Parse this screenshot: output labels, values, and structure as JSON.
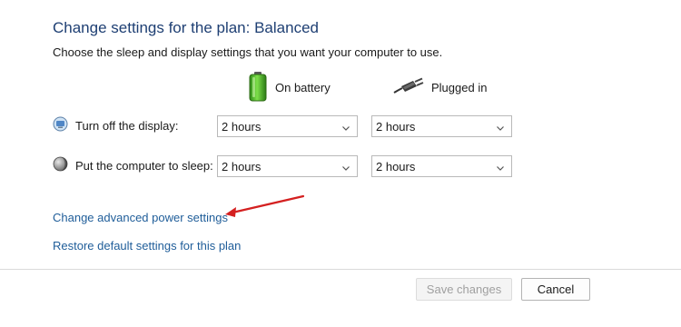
{
  "header": {
    "title": "Change settings for the plan: Balanced",
    "subtitle": "Choose the sleep and display settings that you want your computer to use."
  },
  "columns": {
    "battery": {
      "label": "On battery",
      "icon": "battery-icon"
    },
    "plugged": {
      "label": "Plugged in",
      "icon": "power-plug-icon"
    }
  },
  "settings": {
    "display": {
      "label": "Turn off the display:",
      "icon": "display-icon",
      "battery_value": "2 hours",
      "plugged_value": "2 hours"
    },
    "sleep": {
      "label": "Put the computer to sleep:",
      "icon": "sleep-moon-icon",
      "battery_value": "2 hours",
      "plugged_value": "2 hours"
    }
  },
  "links": {
    "advanced": "Change advanced power settings",
    "restore": "Restore default settings for this plan"
  },
  "buttons": {
    "save": "Save changes",
    "cancel": "Cancel"
  },
  "annotation": {
    "arrow_color": "#d42020"
  },
  "colors": {
    "title": "#1e3f73",
    "link": "#1f5d99"
  }
}
